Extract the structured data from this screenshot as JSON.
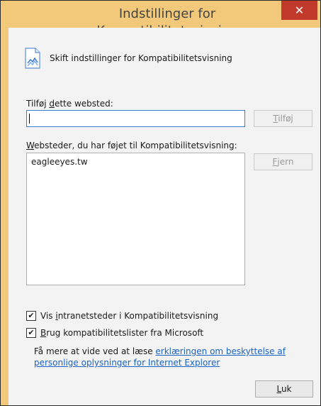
{
  "dialog": {
    "title": "Indstillinger for Kompatibilitetsvisning",
    "close_symbol": "✕",
    "header_text": "Skift indstillinger for Kompatibilitetsvisning",
    "add_site": {
      "label_pre": "Tilføj ",
      "label_underlined": "d",
      "label_post": "ette websted:",
      "input_value": "",
      "button_underlined": "T",
      "button_rest": "ilføj"
    },
    "sites_list": {
      "label_underlined": "W",
      "label_rest": "ebsteder, du har føjet til Kompatibilitetsvisning:",
      "items": [
        "eagleeyes.tw"
      ],
      "remove_button_underlined": "F",
      "remove_button_rest": "jern"
    },
    "options": [
      {
        "pre": "Vis ",
        "underlined": "i",
        "post": "ntranetsteder i Kompatibilitetsvisning",
        "checked": true
      },
      {
        "pre": "",
        "underlined": "B",
        "post": "rug kompatibilitetslister fra Microsoft",
        "checked": true
      }
    ],
    "info_text": "Få mere at vide ved at læse ",
    "info_link": "erklæringen om beskyttelse af personlige oplysninger for Internet Explorer",
    "close_button_underlined": "L",
    "close_button_rest": "uk",
    "check_mark": "✔"
  },
  "colors": {
    "titlebar": "#f2c97a",
    "close": "#c0392b",
    "link": "#1a63c6",
    "input_border": "#3c7fcd"
  },
  "icons": {
    "header": "compatibility-view-icon",
    "close": "close-icon"
  }
}
